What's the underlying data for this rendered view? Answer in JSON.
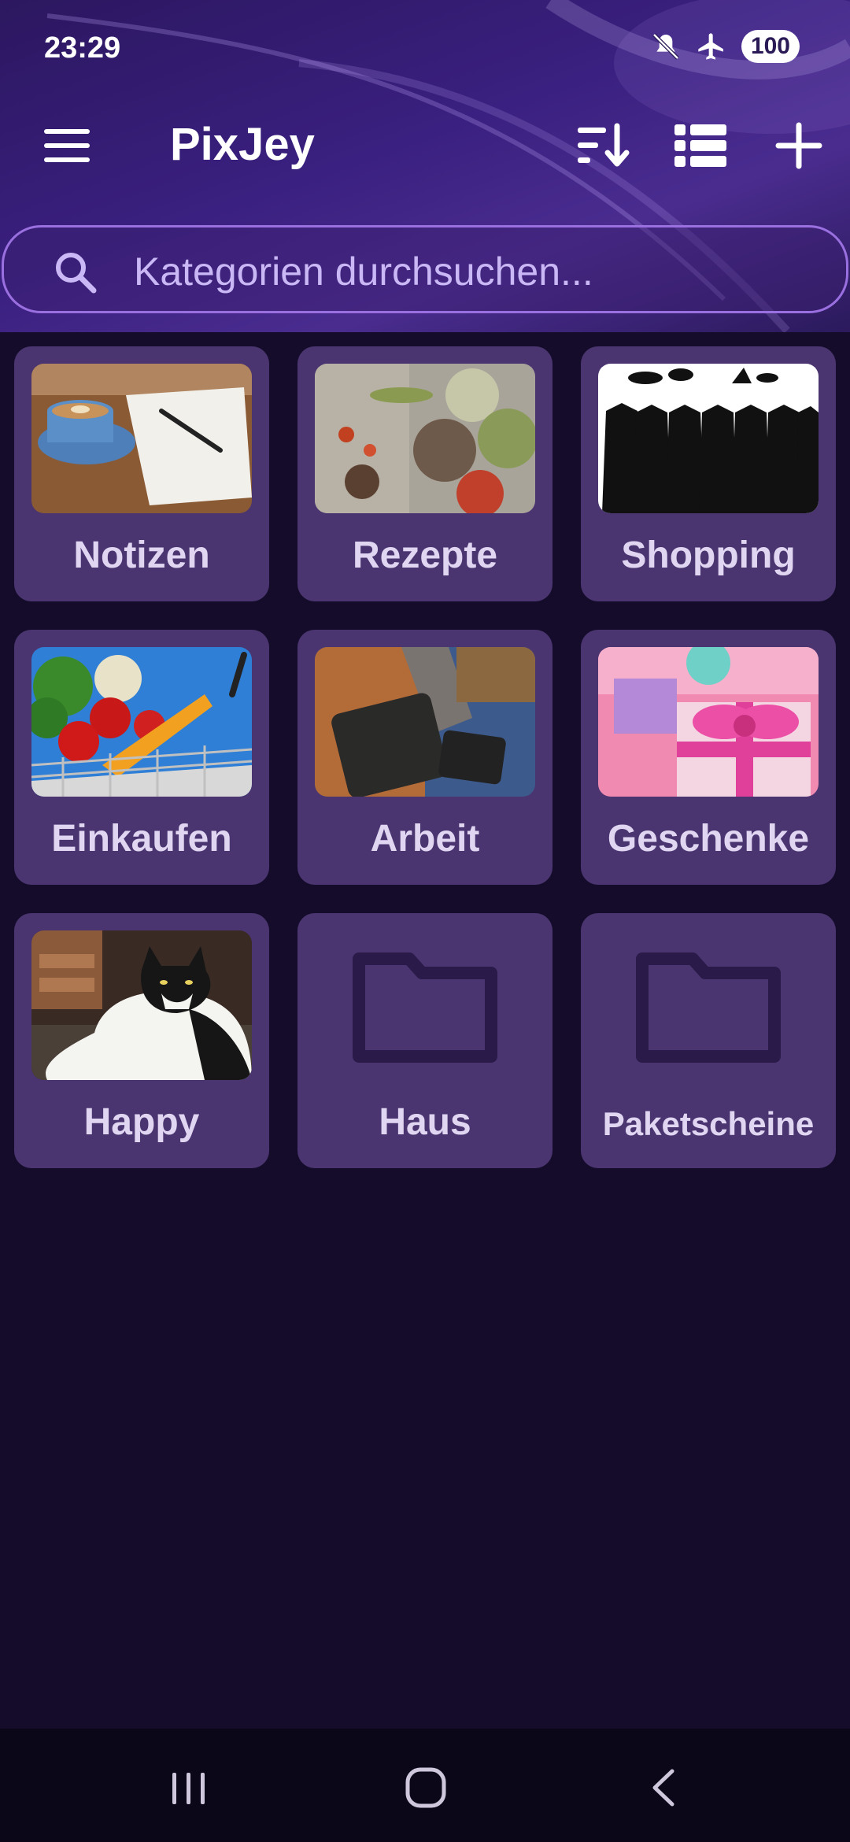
{
  "status_bar": {
    "time": "23:29",
    "battery": "100",
    "icons": [
      "mute-icon",
      "airplane-icon",
      "battery-icon"
    ]
  },
  "toolbar": {
    "title": "PixJey",
    "icons": [
      "menu-icon",
      "sort-icon",
      "list-view-icon",
      "add-icon"
    ]
  },
  "search": {
    "placeholder": "Kategorien durchsuchen..."
  },
  "categories": [
    {
      "label": "Notizen",
      "thumb": "coffee-notebook-image"
    },
    {
      "label": "Rezepte",
      "thumb": "spices-image"
    },
    {
      "label": "Shopping",
      "thumb": "dresses-image"
    },
    {
      "label": "Einkaufen",
      "thumb": "vegetable-cart-image"
    },
    {
      "label": "Arbeit",
      "thumb": "briefcase-image"
    },
    {
      "label": "Geschenke",
      "thumb": "gift-image"
    },
    {
      "label": "Happy",
      "thumb": "cat-image"
    },
    {
      "label": "Haus",
      "thumb": "folder-icon"
    },
    {
      "label": "Paketscheine",
      "thumb": "folder-icon"
    }
  ],
  "colors": {
    "accent": "#9a6fe0",
    "tile_bg": "#4a3570",
    "page_bg": "#140c2a",
    "folder": "#2a1a4a"
  },
  "navbar": {
    "icons": [
      "recent-apps-icon",
      "home-icon",
      "back-icon"
    ]
  }
}
